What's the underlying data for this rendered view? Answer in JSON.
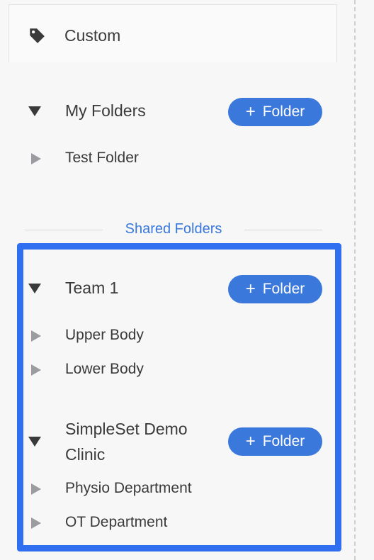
{
  "custom": {
    "label": "Custom",
    "icon": "tag-icon"
  },
  "my_folders": {
    "title": "My Folders",
    "add_button": {
      "plus": "+",
      "label": "Folder"
    },
    "items": [
      {
        "label": "Test Folder"
      }
    ]
  },
  "shared": {
    "divider_label": "Shared Folders",
    "groups": [
      {
        "title": "Team 1",
        "add_button": {
          "plus": "+",
          "label": "Folder"
        },
        "items": [
          {
            "label": "Upper Body"
          },
          {
            "label": "Lower Body"
          }
        ]
      },
      {
        "title_line1": "SimpleSet Demo",
        "title_line2": "Clinic",
        "add_button": {
          "plus": "+",
          "label": "Folder"
        },
        "items": [
          {
            "label": "Physio Department"
          },
          {
            "label": "OT Department"
          }
        ]
      }
    ]
  },
  "colors": {
    "accent": "#3a78db",
    "highlight": "#2f6ff0",
    "text": "#3a3a3a",
    "collapsed_arrow": "#9c9ca0"
  }
}
